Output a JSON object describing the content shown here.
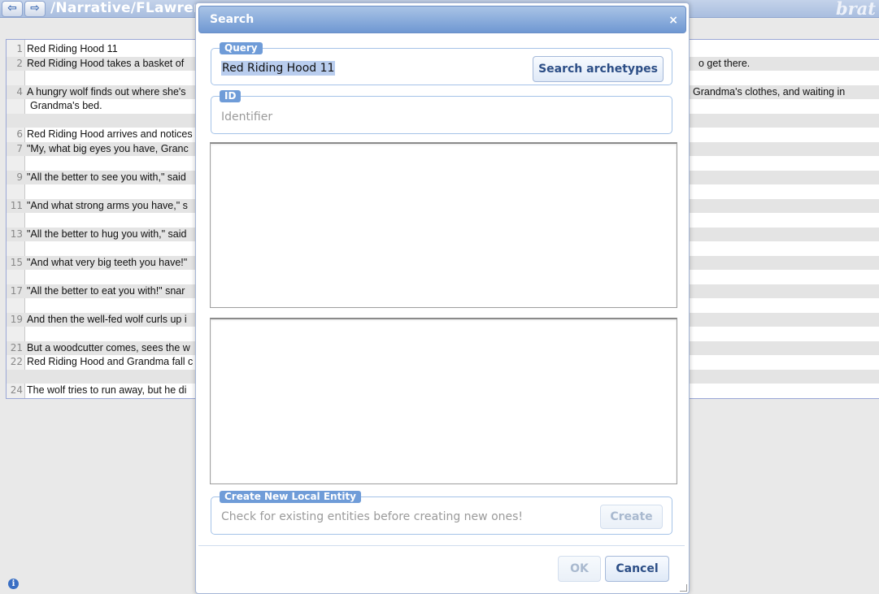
{
  "topbar": {
    "doc_path": "/Narrative/FLawrenc",
    "logo": "brat",
    "back_icon": "arrow-left-icon",
    "forward_icon": "arrow-right-icon"
  },
  "document": {
    "rows": [
      {
        "num": "1",
        "text": "Red Riding Hood 11",
        "right": ""
      },
      {
        "num": "2",
        "text": "Red Riding Hood takes a basket of",
        "right": "o get there."
      },
      {
        "num": "",
        "text": "",
        "right": ""
      },
      {
        "num": "4",
        "text": "A hungry wolf finds out where she's",
        "right": "Grandma's clothes, and waiting in"
      },
      {
        "num": "",
        "text": "Grandma's bed.",
        "right": "",
        "cont": true
      },
      {
        "num": "",
        "text": "",
        "right": ""
      },
      {
        "num": "6",
        "text": "Red Riding Hood arrives and notices",
        "right": ""
      },
      {
        "num": "7",
        "text": "\"My, what big eyes you have, Granc",
        "right": ""
      },
      {
        "num": "",
        "text": "",
        "right": ""
      },
      {
        "num": "9",
        "text": "\"All the better to see you with,\" said",
        "right": ""
      },
      {
        "num": "",
        "text": "",
        "right": ""
      },
      {
        "num": "11",
        "text": "\"And what strong arms you have,\" s",
        "right": ""
      },
      {
        "num": "",
        "text": "",
        "right": ""
      },
      {
        "num": "13",
        "text": "\"All the better to hug you with,\" said",
        "right": ""
      },
      {
        "num": "",
        "text": "",
        "right": ""
      },
      {
        "num": "15",
        "text": "\"And what very big teeth you have!\"",
        "right": ""
      },
      {
        "num": "",
        "text": "",
        "right": ""
      },
      {
        "num": "17",
        "text": "\"All the better to eat you with!\" snar",
        "right": ""
      },
      {
        "num": "",
        "text": "",
        "right": ""
      },
      {
        "num": "19",
        "text": "And then the well-fed wolf curls up i",
        "right": ""
      },
      {
        "num": "",
        "text": "",
        "right": ""
      },
      {
        "num": "21",
        "text": "But a woodcutter comes, sees the w",
        "right": ""
      },
      {
        "num": "22",
        "text": "Red Riding Hood and Grandma fall c",
        "right": ""
      },
      {
        "num": "",
        "text": "",
        "right": ""
      },
      {
        "num": "24",
        "text": "The wolf tries to run away, but he di",
        "right": ""
      }
    ]
  },
  "dialog": {
    "title": "Search",
    "close_glyph": "×",
    "query_legend": "Query",
    "query_value": "Red Riding Hood 11",
    "search_button": "Search archetypes",
    "id_legend": "ID",
    "id_placeholder": "Identifier",
    "create_legend": "Create New Local Entity",
    "create_hint": "Check for existing entities before creating new ones!",
    "create_button": "Create",
    "ok_button": "OK",
    "cancel_button": "Cancel"
  },
  "colors": {
    "accent": "#6f9cd8",
    "title_bar": "#6f98d2",
    "button_text": "#2c4e86"
  }
}
